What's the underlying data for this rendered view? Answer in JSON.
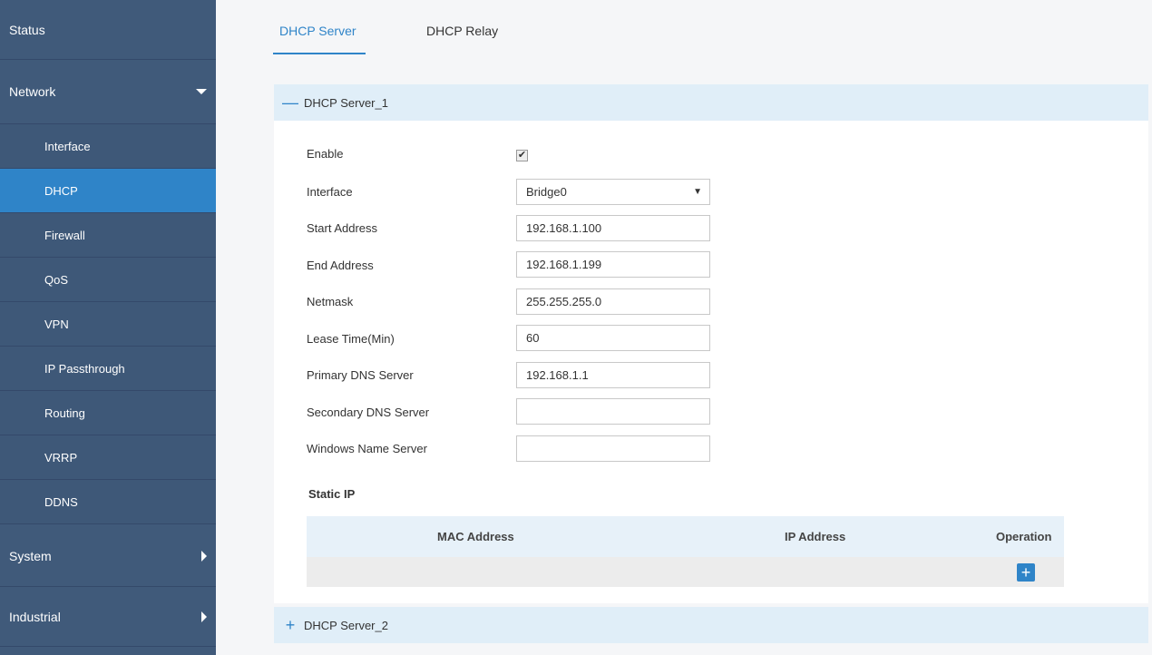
{
  "sidebar": {
    "status": "Status",
    "network": "Network",
    "items": [
      "Interface",
      "DHCP",
      "Firewall",
      "QoS",
      "VPN",
      "IP Passthrough",
      "Routing",
      "VRRP",
      "DDNS"
    ],
    "system": "System",
    "industrial": "Industrial"
  },
  "tabs": {
    "server": "DHCP Server",
    "relay": "DHCP Relay"
  },
  "server1": {
    "title": "DHCP Server_1",
    "enable_label": "Enable",
    "enabled": true,
    "interface_label": "Interface",
    "interface_value": "Bridge0",
    "start_label": "Start Address",
    "start_value": "192.168.1.100",
    "end_label": "End Address",
    "end_value": "192.168.1.199",
    "netmask_label": "Netmask",
    "netmask_value": "255.255.255.0",
    "lease_label": "Lease Time(Min)",
    "lease_value": "60",
    "primary_dns_label": "Primary DNS Server",
    "primary_dns_value": "192.168.1.1",
    "secondary_dns_label": "Secondary DNS Server",
    "secondary_dns_value": "",
    "wins_label": "Windows Name Server",
    "wins_value": ""
  },
  "static_ip": {
    "title": "Static IP",
    "col_mac": "MAC Address",
    "col_ip": "IP Address",
    "col_op": "Operation"
  },
  "server2": {
    "title": "DHCP Server_2"
  },
  "colors": {
    "sidebar": "#405a7a",
    "active": "#2f84c8",
    "section_header": "#e0eef8"
  }
}
